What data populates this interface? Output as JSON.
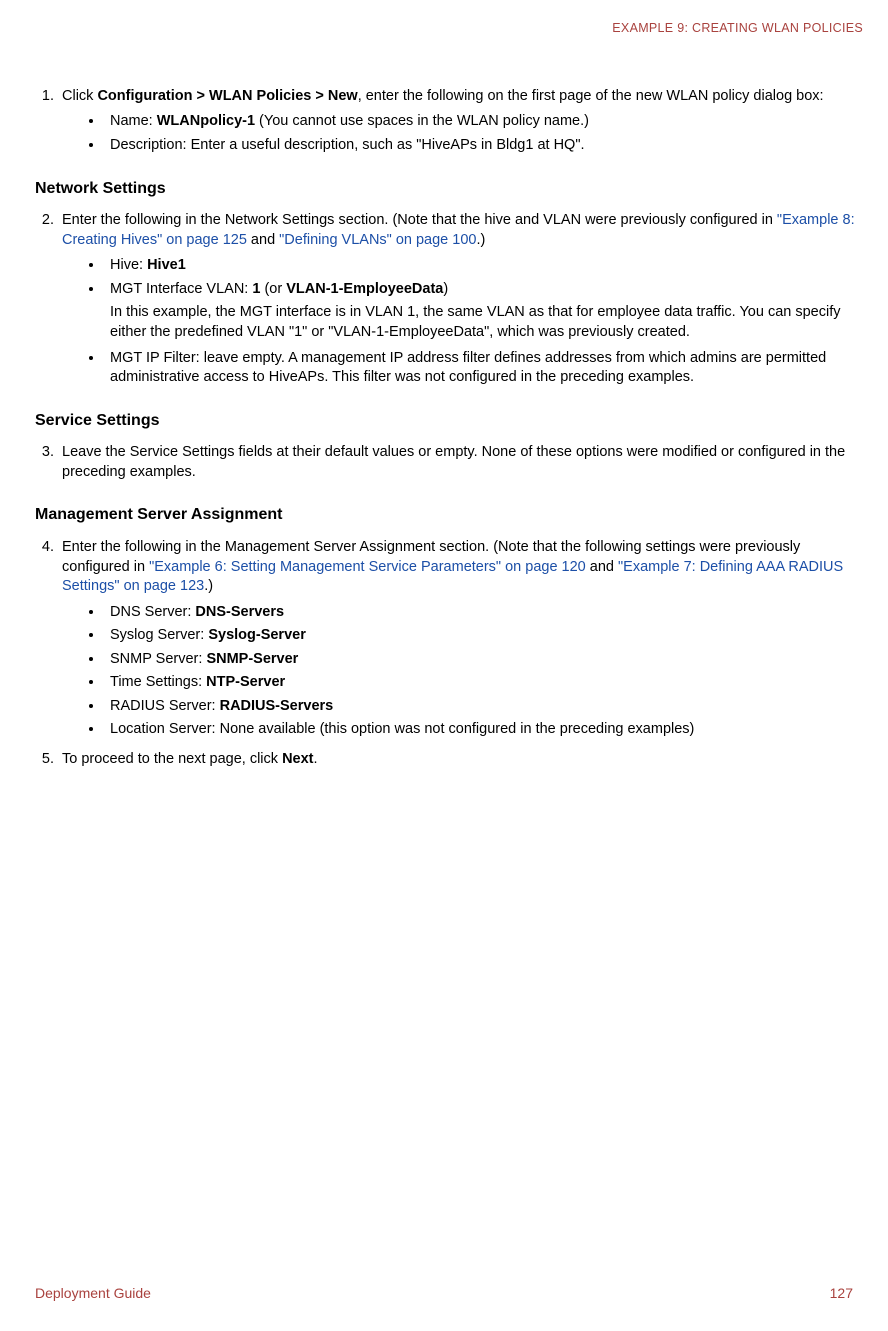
{
  "header": "EXAMPLE 9: CREATING WLAN POLICIES",
  "step1": {
    "intro_a": "Click ",
    "intro_bold": "Configuration > WLAN Policies > New",
    "intro_b": ", enter the following on the first page of the new WLAN policy dialog box:",
    "name_label": "Name: ",
    "name_value": "WLANpolicy-1",
    "name_note": " (You cannot use spaces in the WLAN policy name.)",
    "desc": "Description: Enter a useful description, such as \"HiveAPs in Bldg1 at HQ\"."
  },
  "network": {
    "heading": "Network Settings",
    "intro_a": "Enter the following in the Network Settings section. (Note that the hive and VLAN were previously configured in ",
    "link1": "\"Example 8: Creating Hives\" on page 125",
    "intro_mid": " and ",
    "link2": "\"Defining VLANs\" on page 100",
    "intro_end": ".)",
    "hive_label": "Hive: ",
    "hive_value": "Hive1",
    "mgt_label": "MGT Interface VLAN: ",
    "mgt_v1": "1",
    "mgt_or": " (or ",
    "mgt_v2": "VLAN-1-EmployeeData",
    "mgt_close": ")",
    "mgt_note": "In this example, the MGT interface is in VLAN 1, the same VLAN as that for employee data traffic. You can specify either the predefined VLAN \"1\" or \"VLAN-1-EmployeeData\", which was previously created.",
    "mgt_ip": "MGT IP Filter: leave empty. A management IP address filter defines addresses from which admins are permitted administrative access to HiveAPs. This filter was not configured in the preceding examples."
  },
  "service": {
    "heading": "Service Settings",
    "text": "Leave the Service Settings fields at their default values or empty. None of these options were modified or configured in the preceding examples."
  },
  "mgmt": {
    "heading": "Management Server Assignment",
    "intro_a": "Enter the following in the Management Server Assignment section. (Note that the following settings were previously configured in ",
    "link1": "\"Example 6: Setting Management Service Parameters\" on page 120",
    "intro_mid": " and ",
    "link2": "\"Example 7: Defining AAA RADIUS Settings\" on page 123",
    "intro_end": ".)",
    "dns_l": "DNS Server: ",
    "dns_v": "DNS-Servers",
    "sys_l": "Syslog Server: ",
    "sys_v": "Syslog-Server",
    "snmp_l": "SNMP Server: ",
    "snmp_v": "SNMP-Server",
    "time_l": "Time Settings: ",
    "time_v": "NTP-Server",
    "rad_l": "RADIUS Server: ",
    "rad_v": "RADIUS-Servers",
    "loc": "Location Server: None available (this option was not configured in the preceding examples)"
  },
  "step5_a": "To proceed to the next page, click ",
  "step5_b": "Next",
  "step5_c": ".",
  "footer": {
    "left": "Deployment Guide",
    "right": "127"
  }
}
